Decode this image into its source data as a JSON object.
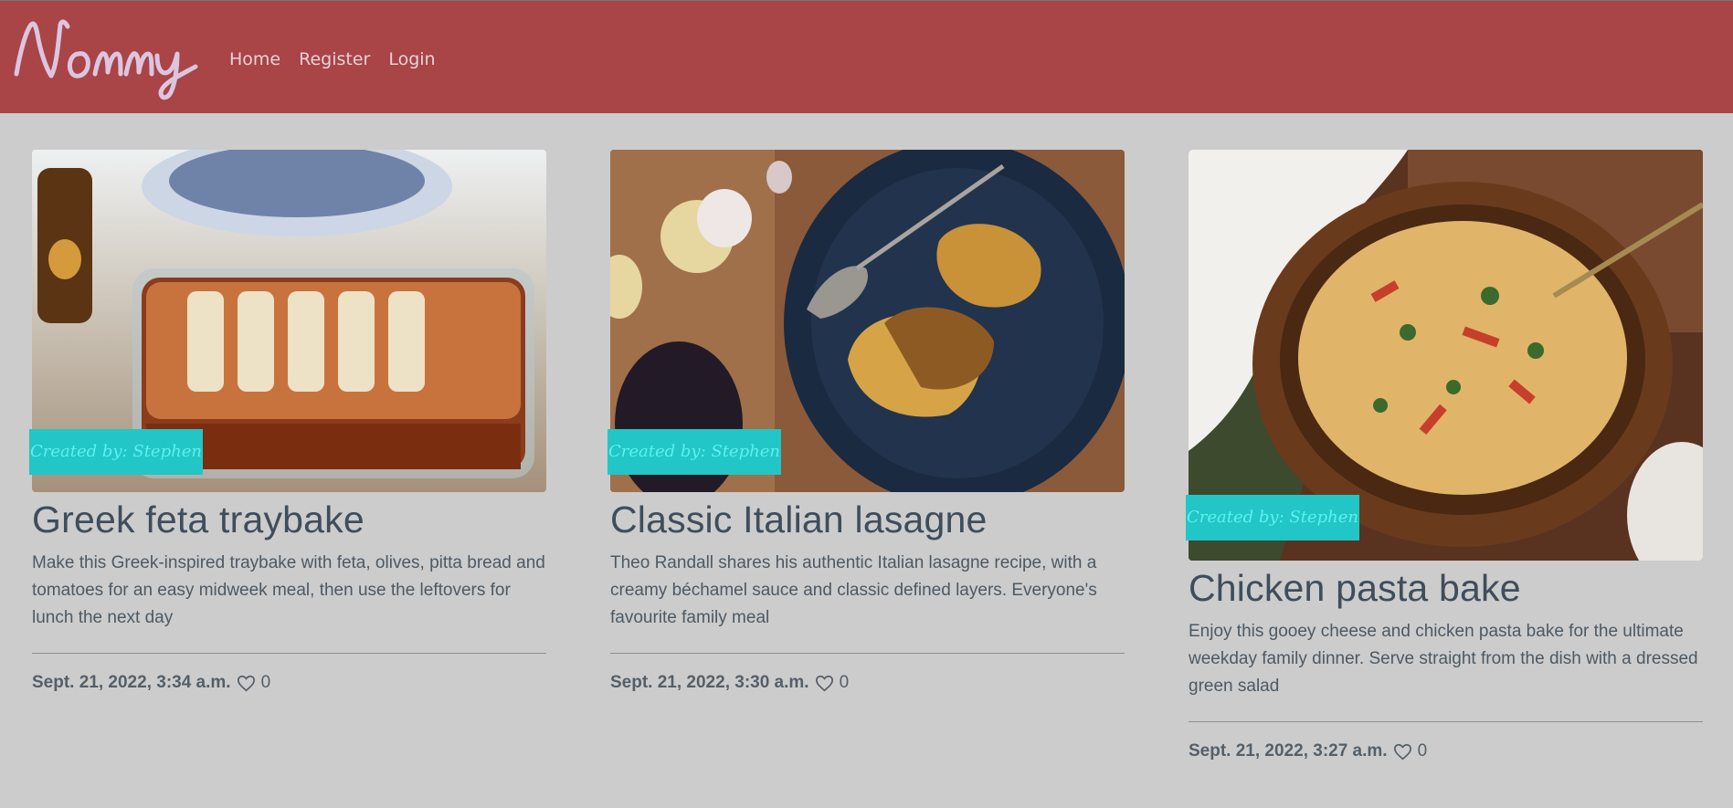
{
  "brand": {
    "logo_text": "Nommy",
    "color": "#dcc5df"
  },
  "nav": {
    "links": [
      {
        "label": "Home"
      },
      {
        "label": "Register"
      },
      {
        "label": "Login"
      }
    ]
  },
  "colors": {
    "navbar": "#a94447",
    "page_background": "#cccccc",
    "badge": "#22c6c6",
    "badge_text": "#5ef0f0",
    "title": "#3f4d5c"
  },
  "cards": [
    {
      "image_alt": "Greek feta traybake photo",
      "author_badge": "Created by: Stephen",
      "title": "Greek feta traybake",
      "description": "Make this Greek-inspired traybake with feta, olives, pitta bread and tomatoes for an easy midweek meal, then use the leftovers for lunch the next day",
      "date": "Sept. 21, 2022, 3:34 a.m.",
      "likes": "0",
      "heart_icon": "heart-outline-icon"
    },
    {
      "image_alt": "Classic Italian lasagne photo",
      "author_badge": "Created by: Stephen",
      "title": "Classic Italian lasagne",
      "description": "Theo Randall shares his authentic Italian lasagne recipe, with a creamy béchamel sauce and classic defined layers. Everyone's favourite family meal",
      "date": "Sept. 21, 2022, 3:30 a.m.",
      "likes": "0",
      "heart_icon": "heart-outline-icon"
    },
    {
      "image_alt": "Chicken pasta bake photo",
      "author_badge": "Created by: Stephen",
      "title": "Chicken pasta bake",
      "description": "Enjoy this gooey cheese and chicken pasta bake for the ultimate weekday family dinner. Serve straight from the dish with a dressed green salad",
      "date": "Sept. 21, 2022, 3:27 a.m.",
      "likes": "0",
      "heart_icon": "heart-outline-icon"
    }
  ]
}
